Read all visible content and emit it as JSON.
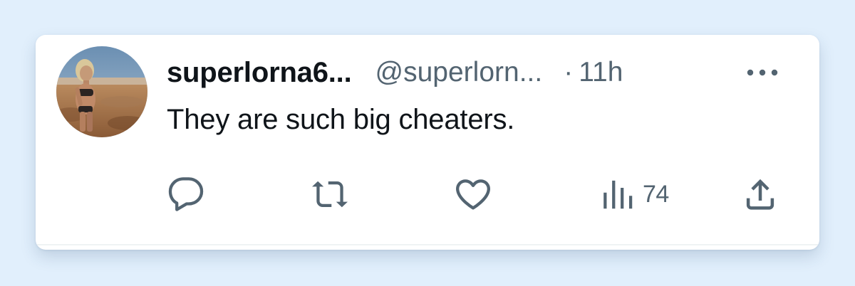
{
  "tweet": {
    "display_name": "superlorna6...",
    "handle": "@superlorn...",
    "separator": "·",
    "time": "11h",
    "text": "They are such big cheaters.",
    "avatar_icon": "profile-photo",
    "more_icon": "more-horizontal-icon"
  },
  "actions": {
    "reply": {
      "icon": "reply-icon",
      "count": ""
    },
    "retweet": {
      "icon": "retweet-icon",
      "count": ""
    },
    "like": {
      "icon": "heart-icon",
      "count": ""
    },
    "views": {
      "icon": "views-chart-icon",
      "count": "74"
    },
    "share": {
      "icon": "share-icon",
      "count": ""
    }
  },
  "colors": {
    "background": "#e1effc",
    "card": "#ffffff",
    "primary_text": "#0f1419",
    "secondary_text": "#536471"
  }
}
